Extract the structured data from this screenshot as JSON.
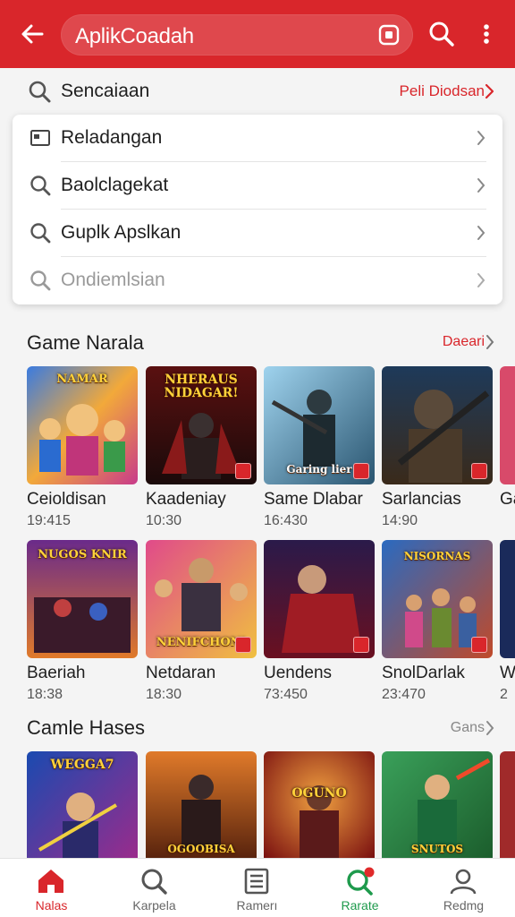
{
  "colors": {
    "brand": "#d9262b",
    "active_green": "#1e9a4c",
    "notification_dot": "#e02a2a"
  },
  "header": {
    "search_value": "AplikCoadah",
    "icons": [
      "back-arrow-icon",
      "scan-icon",
      "search-icon",
      "more-vert-icon"
    ]
  },
  "suggestion_row": {
    "label": "Sencaiaan",
    "link": "Peli Diodsan"
  },
  "dropdown": {
    "items": [
      {
        "label": "Reladangan",
        "icon": "image-icon",
        "muted": false
      },
      {
        "label": "Baolclagekat",
        "icon": "search-icon",
        "muted": false
      },
      {
        "label": "Guplk Apslkan",
        "icon": "search-icon",
        "muted": false
      },
      {
        "label": "Ondiemlsian",
        "icon": "search-icon",
        "muted": true
      }
    ]
  },
  "section1": {
    "title": "Game Narala",
    "link": "Daeari",
    "row1": [
      {
        "name": "Ceioldisan",
        "meta": "19:415",
        "art": "NAMAR"
      },
      {
        "name": "Kaadeniay",
        "meta": "10:30",
        "art": "NHERAUS NIDAGAR!"
      },
      {
        "name": "Same Dlabar",
        "meta": "16:430",
        "art": "Garing lier"
      },
      {
        "name": "Sarlancias",
        "meta": "14:90",
        "art": ""
      },
      {
        "name": "Ga",
        "meta": "",
        "art": ""
      }
    ],
    "row2": [
      {
        "name": "Baeriah",
        "meta": "18:38",
        "art": "NUGOS KNIR"
      },
      {
        "name": "Netdaran",
        "meta": "18:30",
        "art": "NENIFCHON!"
      },
      {
        "name": "Uendens",
        "meta": "73:450",
        "art": ""
      },
      {
        "name": "SnolDarlak",
        "meta": "23:470",
        "art": "NISORNAS"
      },
      {
        "name": "W",
        "meta": "2",
        "art": ""
      }
    ]
  },
  "section2": {
    "title": "Camle Hases",
    "link": "Gans",
    "row": [
      {
        "name": "",
        "meta": "",
        "art": "WEGGA7"
      },
      {
        "name": "",
        "meta": "",
        "art": "OGOOBISA"
      },
      {
        "name": "",
        "meta": "",
        "art": "OGUNO"
      },
      {
        "name": "",
        "meta": "",
        "art": "SNUTOS"
      },
      {
        "name": "",
        "meta": "",
        "art": ""
      }
    ]
  },
  "bottom_nav": {
    "items": [
      {
        "label": "Nalas",
        "icon": "home-icon",
        "state": "active-red"
      },
      {
        "label": "Karpela",
        "icon": "search-icon",
        "state": "normal"
      },
      {
        "label": "Ramerı",
        "icon": "list-icon",
        "state": "normal"
      },
      {
        "label": "Rarate",
        "icon": "search-notify-icon",
        "state": "active-green"
      },
      {
        "label": "Redmg",
        "icon": "person-icon",
        "state": "normal"
      }
    ]
  }
}
